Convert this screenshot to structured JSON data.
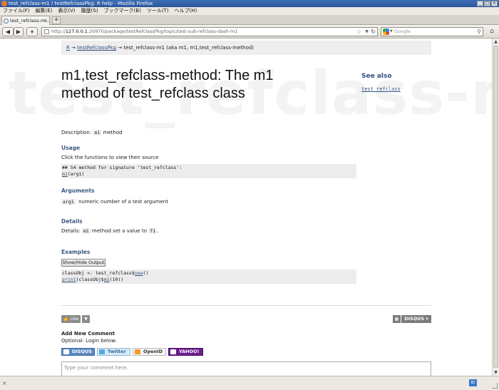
{
  "window": {
    "title": "test_refclass-m1 / testRefclassPkg: R help - Mozilla Firefox",
    "controls": [
      "_",
      "□",
      "×"
    ]
  },
  "menu": [
    "ファイル(F)",
    "編集(E)",
    "表示(V)",
    "履歴(S)",
    "ブックマーク(B)",
    "ツール(T)",
    "ヘルプ(H)"
  ],
  "tab": {
    "title": "test_refclass-m...",
    "close": "×",
    "new": "+"
  },
  "nav": {
    "back": "◀",
    "forward": "▶",
    "url_host": "127.0.0.1",
    "url_rest": ":20970/package/testRefclassPkg/topic/test-sub-refclass-dash-m1",
    "search_placeholder": "Google",
    "home": "⌂"
  },
  "page": {
    "watermark": "test_refclass-m",
    "breadcrumb": {
      "root": "R",
      "sep1": " → ",
      "package": "testRefclassPkg",
      "sep2": " → ",
      "topic": "test_refclass-m1 (aka m1, m1,test_refclass-method)"
    },
    "title": "m1,test_refclass-method: The m1 method of test_refclass class",
    "see_also": {
      "heading": "See also",
      "link": "test_refclass"
    },
    "description": {
      "label": "Description: ",
      "code": "m1",
      "rest": " method"
    },
    "usage": {
      "heading": "Usage",
      "hint": "Click the functions to view their source",
      "line1": "## S4 method for signature 'test_refclass':",
      "fn": "m1",
      "args": "(arg1)"
    },
    "arguments": {
      "heading": "Arguments",
      "name": "arg1",
      "desc": "numeric number of a test argument"
    },
    "details": {
      "heading": "Details",
      "label": "Details: ",
      "code1": "m1",
      "mid": " method set a value to ",
      "code2": "f1",
      "end": "."
    },
    "examples": {
      "heading": "Examples",
      "button": "Show/Hide Output",
      "l1_pre": "classObj <- test_refclass$",
      "l1_fn": "new",
      "l1_post": "()",
      "l2_fn": "print",
      "l2_mid": "(classObj$",
      "l2_fn2": "m1",
      "l2_post": "(10))"
    }
  },
  "comments": {
    "like": "Like",
    "dislike": "▼",
    "disqus": "DISQUS",
    "disqus_menu_arrow": "▾",
    "add_new": "Add New Comment",
    "optional": "Optional: Login below.",
    "logins": [
      "DISQUS",
      "Twitter",
      "OpenID",
      "YAHOO!"
    ],
    "placeholder": "Type your comment here."
  },
  "status": {
    "close": "×",
    "badge": "BI"
  }
}
